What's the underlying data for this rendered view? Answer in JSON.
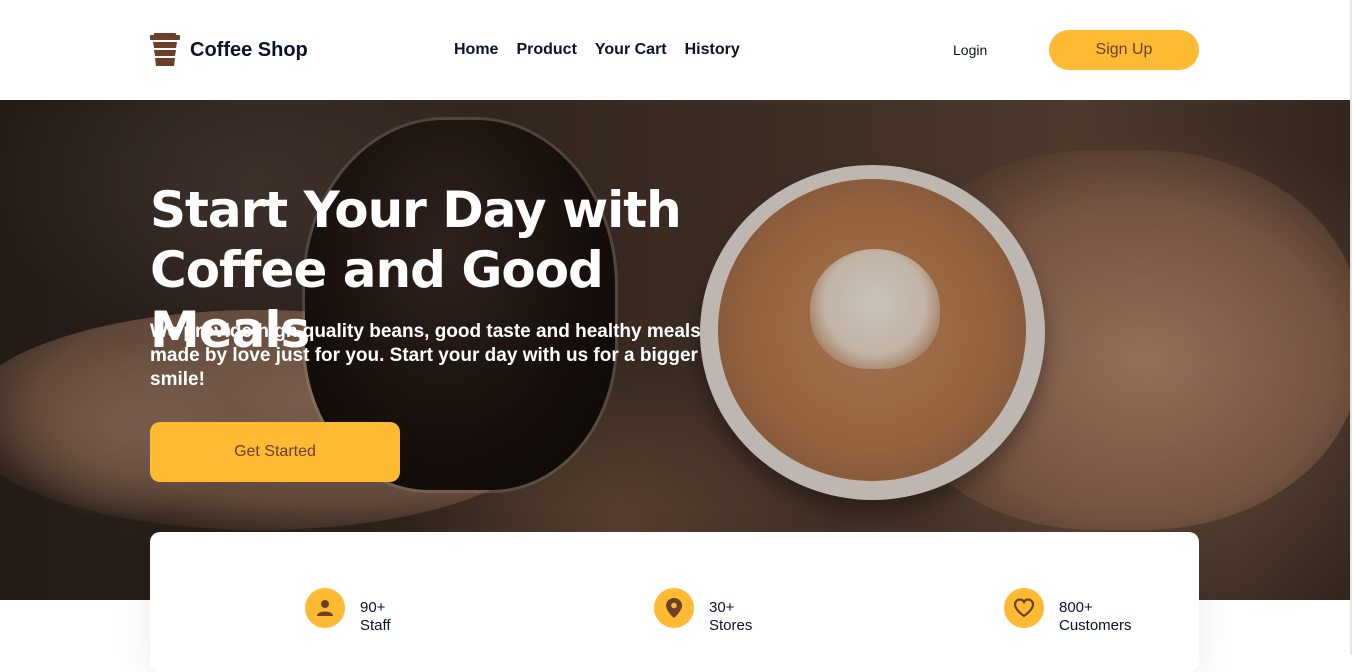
{
  "brand": {
    "name": "Coffee Shop",
    "icon": "coffee-cup-icon"
  },
  "nav": {
    "links": [
      "Home",
      "Product",
      "Your Cart",
      "History"
    ],
    "login_label": "Login",
    "signup_label": "Sign Up"
  },
  "hero": {
    "title_line1": "Start Your Day with",
    "title_line2": "Coffee and Good Meals",
    "subtitle": "We provide high quality beans, good taste and healthy meals made by love just for you. Start your day with us for a bigger smile!",
    "cta_label": "Get Started"
  },
  "stats": [
    {
      "icon": "user-icon",
      "value": "90+",
      "label": "Staff"
    },
    {
      "icon": "location-pin-icon",
      "value": "30+",
      "label": "Stores"
    },
    {
      "icon": "heart-icon",
      "value": "800+",
      "label": "Customers"
    }
  ],
  "colors": {
    "accent": "#ffba33",
    "accent_text": "#6a4029",
    "dark_text": "#0b132a",
    "brand_icon": "#6a4029"
  }
}
